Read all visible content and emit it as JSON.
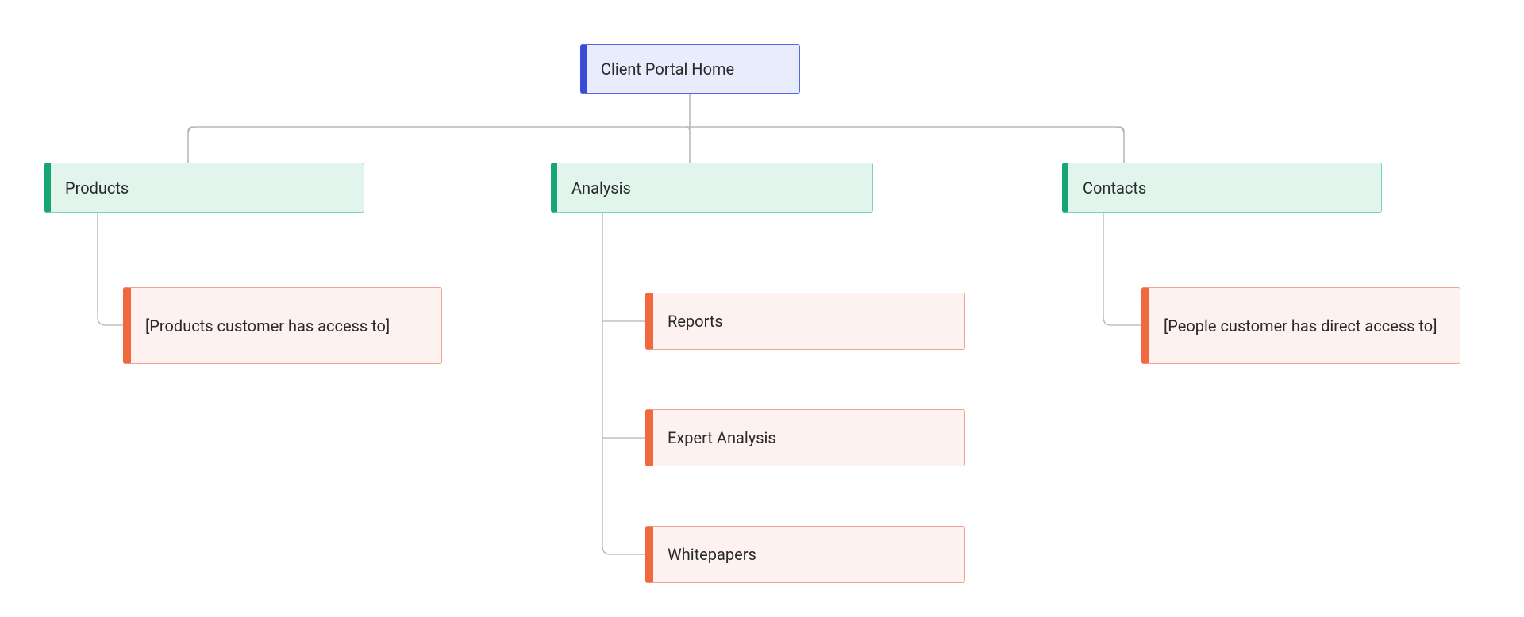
{
  "root": {
    "label": "Client Portal Home"
  },
  "sections": [
    {
      "label": "Products",
      "children": [
        {
          "label": "[Products customer has access to]"
        }
      ]
    },
    {
      "label": "Analysis",
      "children": [
        {
          "label": "Reports"
        },
        {
          "label": "Expert Analysis"
        },
        {
          "label": "Whitepapers"
        }
      ]
    },
    {
      "label": "Contacts",
      "children": [
        {
          "label": "[People customer has direct access to]"
        }
      ]
    }
  ],
  "colors": {
    "root_bg": "#e8ecfd",
    "root_border": "#5468e6",
    "root_accent": "#3b4dd8",
    "section_bg": "#e1f5ed",
    "section_border": "#7bd4b7",
    "section_accent": "#17a673",
    "child_bg": "#fdf2ef",
    "child_border": "#f0a48f",
    "child_accent": "#f2683e"
  }
}
